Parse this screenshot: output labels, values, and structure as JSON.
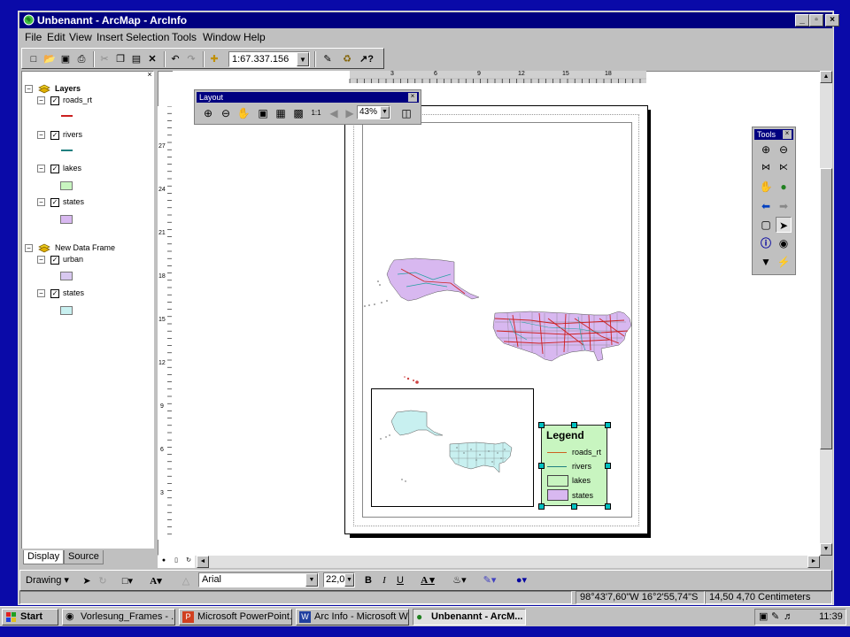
{
  "window": {
    "title": "Unbenannt - ArcMap - ArcInfo",
    "controls": {
      "minimize": "_",
      "maximize": "▫",
      "close": "×"
    }
  },
  "menu": [
    "File",
    "Edit",
    "View",
    "Insert",
    "Selection",
    "Tools",
    "Window",
    "Help"
  ],
  "toolbar": {
    "scale": "1:67.337.156"
  },
  "toc": {
    "frames": [
      {
        "name": "Layers",
        "layers": [
          {
            "name": "roads_rt",
            "symbol": "line",
            "color": "#cc2020"
          },
          {
            "name": "rivers",
            "symbol": "line",
            "color": "#208080"
          },
          {
            "name": "lakes",
            "symbol": "patch",
            "color": "#c8f5c0"
          },
          {
            "name": "states",
            "symbol": "patch",
            "color": "#d8b8f0"
          }
        ]
      },
      {
        "name": "New Data Frame",
        "layers": [
          {
            "name": "urban",
            "symbol": "patch",
            "color": "#d8c8f0"
          },
          {
            "name": "states",
            "symbol": "patch",
            "color": "#c8f0f0"
          }
        ]
      }
    ],
    "tabs": {
      "display": "Display",
      "source": "Source"
    }
  },
  "ruler": {
    "horizontal": [
      "3",
      "6",
      "9",
      "12",
      "15",
      "18"
    ],
    "vertical": [
      "27",
      "24",
      "21",
      "18",
      "15",
      "12",
      "9",
      "6",
      "3"
    ]
  },
  "layout_toolbar": {
    "title": "Layout",
    "zoom": "43%"
  },
  "tools_toolbar": {
    "title": "Tools"
  },
  "legend": {
    "title": "Legend",
    "items": [
      {
        "label": "roads_rt",
        "type": "line",
        "color": "#cc6020"
      },
      {
        "label": "rivers",
        "type": "line",
        "color": "#208080"
      },
      {
        "label": "lakes",
        "type": "patch",
        "color": "#c8f5c0"
      },
      {
        "label": "states",
        "type": "patch",
        "color": "#d8b8f0"
      }
    ]
  },
  "drawing": {
    "menu": "Drawing",
    "font": "Arial",
    "size": "22,0",
    "bold": "B",
    "italic": "I",
    "underline": "U",
    "text_tool": "A"
  },
  "status": {
    "coords": "98°43'7,60\"W 16°2'55,74\"S",
    "page_pos": "14,50  4,70 Centimeters"
  },
  "taskbar": {
    "start": "Start",
    "tasks": [
      {
        "label": "Vorlesung_Frames - ...",
        "active": false
      },
      {
        "label": "Microsoft PowerPoint...",
        "active": false
      },
      {
        "label": "Arc Info - Microsoft W...",
        "active": false
      },
      {
        "label": "Unbenannt - ArcM...",
        "active": true
      }
    ],
    "clock": "11:39"
  },
  "colors": {
    "title_bar": "#000080",
    "face": "#c0c0c0",
    "desktop": "#0a0aa8",
    "states_fill": "#d8b8f0",
    "overview_fill": "#c8f0f0",
    "roads": "#cc2020",
    "rivers": "#20a0a0",
    "selection": "#00c0c0"
  }
}
